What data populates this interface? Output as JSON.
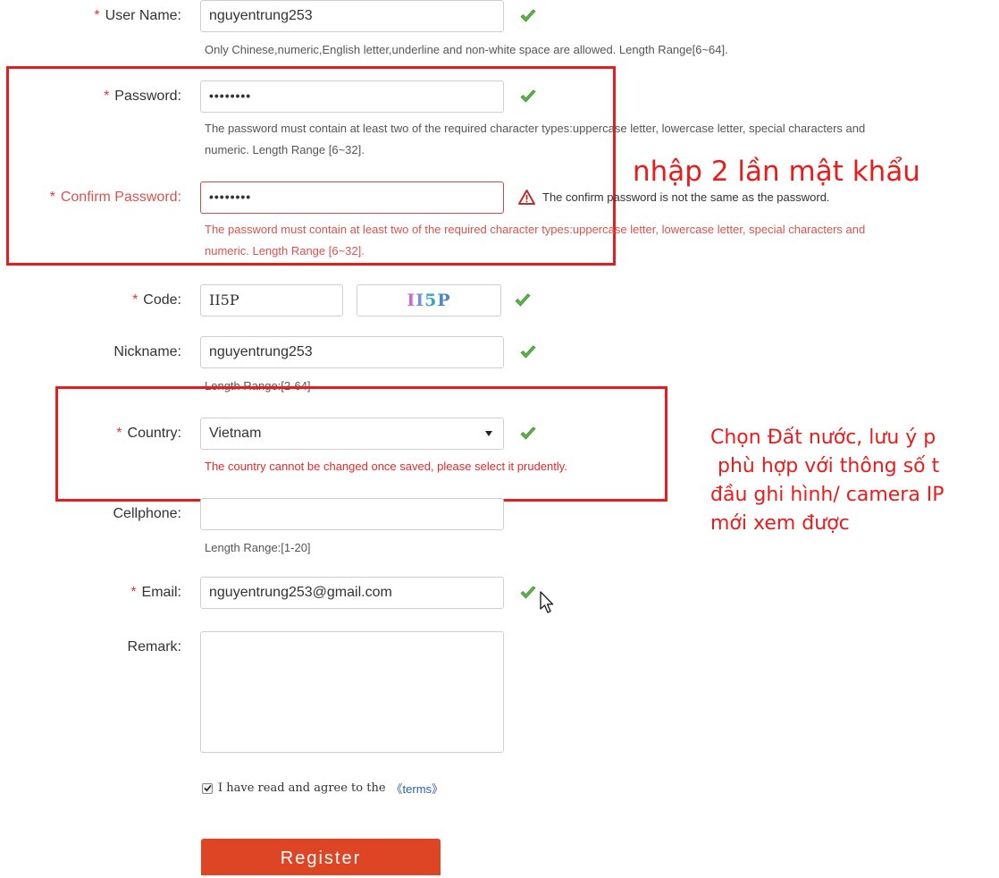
{
  "form": {
    "username": {
      "label": "User Name:",
      "value": "nguyentrung253",
      "hint": "Only Chinese,numeric,English letter,underline and non-white space are allowed. Length Range[6~64]."
    },
    "password": {
      "label": "Password:",
      "value": "••••••••",
      "hint_line1": "The password must contain at least two of the required character types:uppercase letter, lowercase letter, special characters and",
      "hint_line2": "numeric. Length Range [6~32]."
    },
    "confirm_password": {
      "label": "Confirm Password:",
      "value": "••••••••",
      "error": "The confirm password is not the same as the password.",
      "hint_line1": "The password must contain at least two of the required character types:uppercase letter, lowercase letter, special characters and",
      "hint_line2": "numeric. Length Range [6~32]."
    },
    "code": {
      "label": "Code:",
      "value": "II5P",
      "captcha_text": "II5P"
    },
    "nickname": {
      "label": "Nickname:",
      "value": "nguyentrung253",
      "hint": "Length Range:[2-64]"
    },
    "country": {
      "label": "Country:",
      "value": "Vietnam",
      "warning": "The country cannot be changed once saved, please select it prudently."
    },
    "cellphone": {
      "label": "Cellphone:",
      "value": "",
      "hint": "Length Range:[1-20]"
    },
    "email": {
      "label": "Email:",
      "value": "nguyentrung253@gmail.com"
    },
    "remark": {
      "label": "Remark:",
      "value": ""
    },
    "required_mark": "*",
    "agree": {
      "text": "I have read and agree to the",
      "link": "《terms》",
      "checked": true
    },
    "register_label": "Register"
  },
  "annotations": {
    "password_note": "nhập 2 lần mật khẩu",
    "country_note_line1": "Chọn Đất nước, lưu ý p",
    "country_note_line2": "phù hợp với thông số t",
    "country_note_line3": "đầu ghi hình/ camera IP",
    "country_note_line4": "mới xem được"
  },
  "colors": {
    "accent_red": "#e81c1c",
    "button": "#dd4524",
    "ok_green": "#4caf3c",
    "error_red": "#d9534f"
  },
  "icons": [
    "check-icon",
    "warning-icon",
    "mouse-cursor-icon",
    "dropdown-arrow-icon"
  ]
}
